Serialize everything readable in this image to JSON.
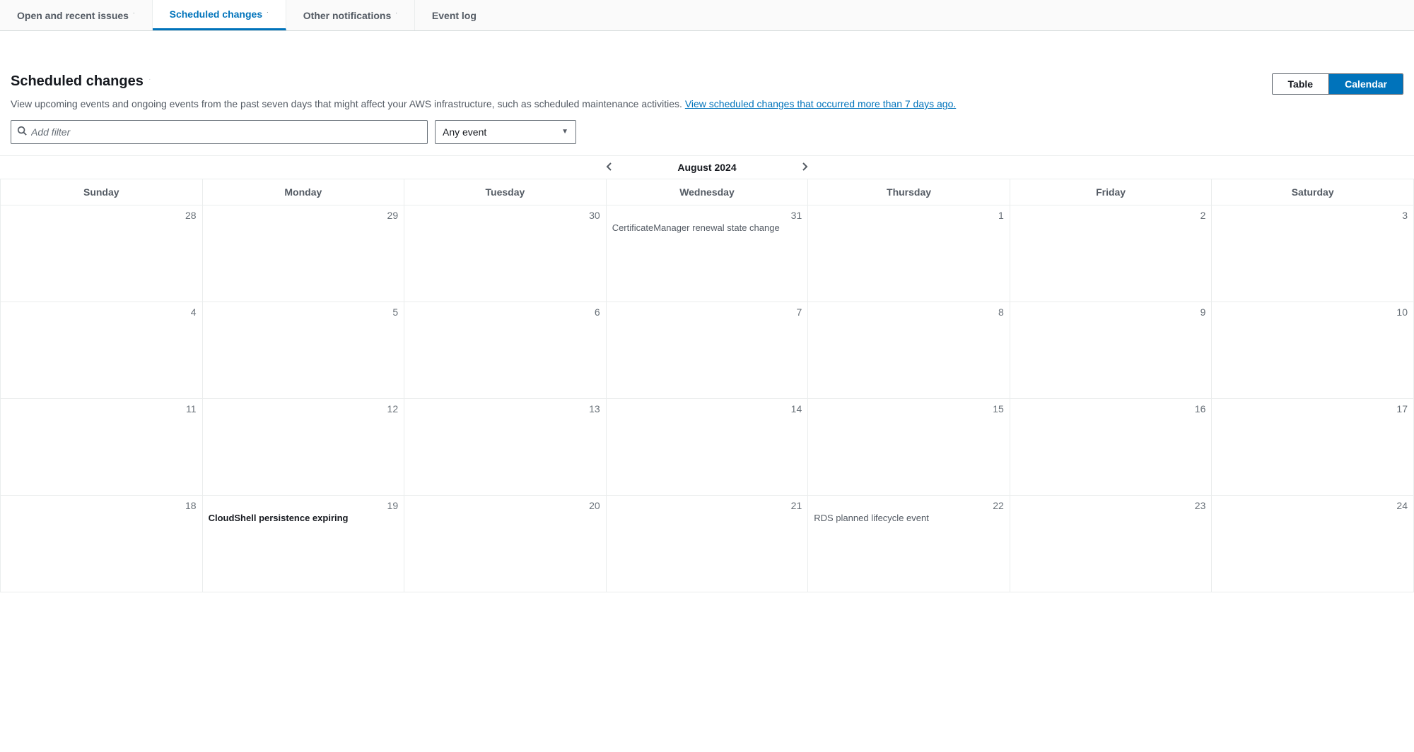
{
  "tabs": [
    {
      "label": "Open and recent issues",
      "badge": "˙"
    },
    {
      "label": "Scheduled changes",
      "badge": "˙"
    },
    {
      "label": "Other notifications",
      "badge": "˙"
    },
    {
      "label": "Event log",
      "badge": ""
    }
  ],
  "header": {
    "title": "Scheduled changes",
    "title_badge": "˙",
    "toggle": {
      "table": "Table",
      "calendar": "Calendar"
    },
    "desc_pre": "View upcoming events and ongoing events from the past seven days that might affect your AWS infrastructure, such as scheduled maintenance activities. ",
    "desc_link": "View scheduled changes that occurred more than 7 days ago."
  },
  "filters": {
    "add_filter_placeholder": "Add filter",
    "dropdown_selected": "Any event"
  },
  "calendar_header": {
    "month": "August 2024",
    "days": [
      "Sunday",
      "Monday",
      "Tuesday",
      "Wednesday",
      "Thursday",
      "Friday",
      "Saturday"
    ]
  },
  "weeks": [
    [
      {
        "num": "28"
      },
      {
        "num": "29"
      },
      {
        "num": "30"
      },
      {
        "num": "31",
        "event": "CertificateManager renewal state change",
        "bold": false
      },
      {
        "num": "1"
      },
      {
        "num": "2"
      },
      {
        "num": "3"
      }
    ],
    [
      {
        "num": "4"
      },
      {
        "num": "5"
      },
      {
        "num": "6"
      },
      {
        "num": "7"
      },
      {
        "num": "8"
      },
      {
        "num": "9"
      },
      {
        "num": "10"
      }
    ],
    [
      {
        "num": "11"
      },
      {
        "num": "12"
      },
      {
        "num": "13"
      },
      {
        "num": "14"
      },
      {
        "num": "15"
      },
      {
        "num": "16"
      },
      {
        "num": "17"
      }
    ],
    [
      {
        "num": "18"
      },
      {
        "num": "19",
        "event": "CloudShell persistence expiring",
        "bold": true
      },
      {
        "num": "20"
      },
      {
        "num": "21"
      },
      {
        "num": "22",
        "event": "RDS planned lifecycle event",
        "bold": false
      },
      {
        "num": "23"
      },
      {
        "num": "24"
      }
    ]
  ]
}
